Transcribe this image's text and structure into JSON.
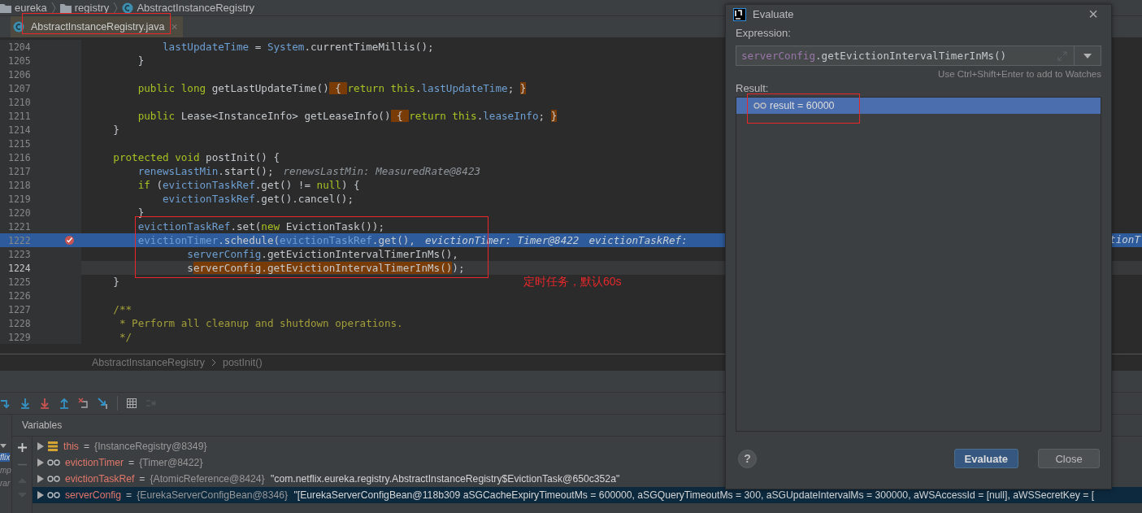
{
  "breadcrumbs": [
    {
      "kind": "folder",
      "label": "eureka"
    },
    {
      "kind": "folder",
      "label": "registry"
    },
    {
      "kind": "class",
      "label": "AbstractInstanceRegistry"
    }
  ],
  "tabs": [
    {
      "label": "AbstractInstanceRegistry.java",
      "selected": true,
      "annotated": true,
      "close": "×"
    }
  ],
  "code_lines": [
    {
      "number": "1204",
      "execution_point": false,
      "caret_line": false,
      "breakpoint": false,
      "annotated": false,
      "tokens": [
        {
          "kind": "field",
          "text": "            lastUpdateTime"
        },
        {
          "kind": "plain",
          "text": " = "
        },
        {
          "kind": "field",
          "text": "System"
        },
        {
          "kind": "plain",
          "text": ".currentTimeMillis();"
        }
      ]
    },
    {
      "number": "1205",
      "execution_point": false,
      "caret_line": false,
      "breakpoint": false,
      "annotated": false,
      "tokens": [
        {
          "kind": "plain",
          "text": "        }"
        }
      ]
    },
    {
      "number": "1206",
      "execution_point": false,
      "caret_line": false,
      "breakpoint": false,
      "annotated": false
    },
    {
      "number": "1207",
      "execution_point": false,
      "caret_line": false,
      "breakpoint": false,
      "annotated": false,
      "tokens": [
        {
          "kind": "kw",
          "text": "        public long "
        },
        {
          "kind": "plain",
          "text": "getLastUpdateTime()"
        },
        {
          "kind": "fold",
          "text": " { "
        },
        {
          "kind": "kw",
          "text": "return this"
        },
        {
          "kind": "plain",
          "text": "."
        },
        {
          "kind": "field",
          "text": "lastUpdateTime"
        },
        {
          "kind": "plain",
          "text": "; "
        },
        {
          "kind": "fold",
          "text": "}"
        }
      ]
    },
    {
      "number": "1210",
      "execution_point": false,
      "caret_line": false,
      "breakpoint": false,
      "annotated": false
    },
    {
      "number": "1211",
      "execution_point": false,
      "caret_line": false,
      "breakpoint": false,
      "annotated": false,
      "tokens": [
        {
          "kind": "kw",
          "text": "        public "
        },
        {
          "kind": "plain",
          "text": "Lease<InstanceInfo> getLeaseInfo()"
        },
        {
          "kind": "fold",
          "text": " { "
        },
        {
          "kind": "kw",
          "text": "return this"
        },
        {
          "kind": "plain",
          "text": "."
        },
        {
          "kind": "field",
          "text": "leaseInfo"
        },
        {
          "kind": "plain",
          "text": "; "
        },
        {
          "kind": "fold",
          "text": "}"
        }
      ]
    },
    {
      "number": "1214",
      "execution_point": false,
      "caret_line": false,
      "breakpoint": false,
      "annotated": false,
      "tokens": [
        {
          "kind": "plain",
          "text": "    }"
        }
      ]
    },
    {
      "number": "1215",
      "execution_point": false,
      "caret_line": false,
      "breakpoint": false,
      "annotated": false
    },
    {
      "number": "1216",
      "execution_point": false,
      "caret_line": false,
      "breakpoint": false,
      "annotated": false,
      "tokens": [
        {
          "kind": "kw",
          "text": "    protected void "
        },
        {
          "kind": "plain",
          "text": "postInit() {"
        }
      ]
    },
    {
      "number": "1217",
      "execution_point": false,
      "caret_line": false,
      "breakpoint": false,
      "annotated": false,
      "tokens": [
        {
          "kind": "field",
          "text": "        renewsLastMin"
        },
        {
          "kind": "plain",
          "text": ".start();"
        }
      ],
      "hints": [
        "renewsLastMin: MeasuredRate@8423"
      ]
    },
    {
      "number": "1218",
      "execution_point": false,
      "caret_line": false,
      "breakpoint": false,
      "annotated": false,
      "tokens": [
        {
          "kind": "kw",
          "text": "        if "
        },
        {
          "kind": "plain",
          "text": "("
        },
        {
          "kind": "field",
          "text": "evictionTaskRef"
        },
        {
          "kind": "plain",
          "text": ".get() != "
        },
        {
          "kind": "kw",
          "text": "null"
        },
        {
          "kind": "plain",
          "text": ") {"
        }
      ]
    },
    {
      "number": "1219",
      "execution_point": false,
      "caret_line": false,
      "breakpoint": false,
      "annotated": false,
      "tokens": [
        {
          "kind": "field",
          "text": "            evictionTaskRef"
        },
        {
          "kind": "plain",
          "text": ".get().cancel();"
        }
      ]
    },
    {
      "number": "1220",
      "execution_point": false,
      "caret_line": false,
      "breakpoint": false,
      "annotated": false,
      "tokens": [
        {
          "kind": "plain",
          "text": "        }"
        }
      ]
    },
    {
      "number": "1221",
      "execution_point": false,
      "caret_line": false,
      "breakpoint": false,
      "annotated": true,
      "tokens": [
        {
          "kind": "field",
          "text": "        evictionTaskRef"
        },
        {
          "kind": "plain",
          "text": ".set("
        },
        {
          "kind": "kw",
          "text": "new "
        },
        {
          "kind": "plain",
          "text": "EvictionTask());"
        }
      ]
    },
    {
      "number": "1222",
      "execution_point": true,
      "caret_line": false,
      "breakpoint": true,
      "annotated": true,
      "tokens": [
        {
          "kind": "field",
          "text": "        evictionTimer"
        },
        {
          "kind": "plain",
          "text": ".schedule("
        },
        {
          "kind": "field",
          "text": "evictionTaskRef"
        },
        {
          "kind": "plain",
          "text": ".get(),"
        }
      ],
      "hints": [
        "evictionTimer: Timer@8422",
        "evictionTaskRef:"
      ],
      "tail": "tionT"
    },
    {
      "number": "1223",
      "execution_point": false,
      "caret_line": false,
      "breakpoint": false,
      "annotated": true,
      "tokens": [
        {
          "kind": "field",
          "text": "                serverConfig"
        },
        {
          "kind": "plain",
          "text": ".getEvictionIntervalTimerInMs(),"
        }
      ]
    },
    {
      "number": "1224",
      "execution_point": false,
      "caret_line": true,
      "breakpoint": false,
      "annotated": true,
      "tokens": [
        {
          "kind": "plain",
          "text": "                s"
        },
        {
          "kind": "fold",
          "text": "erverConfig.getEvictionIntervalTimerInMs()"
        },
        {
          "kind": "plain",
          "text": ");"
        }
      ]
    },
    {
      "number": "1225",
      "execution_point": false,
      "caret_line": false,
      "breakpoint": false,
      "annotated": false,
      "tokens": [
        {
          "kind": "plain",
          "text": "    }"
        }
      ]
    },
    {
      "number": "1226",
      "execution_point": false,
      "caret_line": false,
      "breakpoint": false,
      "annotated": false
    },
    {
      "number": "1227",
      "execution_point": false,
      "caret_line": false,
      "breakpoint": false,
      "annotated": false,
      "tokens": [
        {
          "kind": "comment",
          "text": "    /**"
        }
      ]
    },
    {
      "number": "1228",
      "execution_point": false,
      "caret_line": false,
      "breakpoint": false,
      "annotated": false,
      "tokens": [
        {
          "kind": "comment",
          "text": "     * Perform all cleanup and shutdown operations."
        }
      ]
    },
    {
      "number": "1229",
      "execution_point": false,
      "caret_line": false,
      "breakpoint": false,
      "annotated": false,
      "tokens": [
        {
          "kind": "comment",
          "text": "     */"
        }
      ]
    }
  ],
  "annotation_note": "定时任务，默认60s",
  "editor_breadcrumbs": [
    "AbstractInstanceRegistry",
    "postInit()"
  ],
  "debug_toolbar": [
    {
      "kind": "step-over",
      "disabled": false
    },
    {
      "kind": "step-into",
      "disabled": false
    },
    {
      "kind": "force-step-into",
      "disabled": false
    },
    {
      "kind": "step-out",
      "disabled": false
    },
    {
      "kind": "drop-frame",
      "disabled": false
    },
    {
      "kind": "run-to-cursor",
      "disabled": false
    },
    {
      "kind": "evaluate",
      "disabled": false
    },
    {
      "kind": "trace",
      "disabled": true
    }
  ],
  "frames": [
    {
      "text": "flix",
      "selected": true
    },
    {
      "text": "mp",
      "selected": false
    },
    {
      "text": "rar",
      "selected": false
    }
  ],
  "variables": {
    "title": "Variables",
    "rows": [
      {
        "kind": "field",
        "name": "this",
        "equals": "=",
        "value": "{InstanceRegistry@8349}",
        "selected": false
      },
      {
        "kind": "watch",
        "name": "evictionTimer",
        "equals": "=",
        "value": "{Timer@8422}",
        "selected": false
      },
      {
        "kind": "watch",
        "name": "evictionTaskRef",
        "equals": "=",
        "value": "{AtomicReference@8424}",
        "string": "\"com.netflix.eureka.registry.AbstractInstanceRegistry$EvictionTask@650c352a\"",
        "selected": false
      },
      {
        "kind": "watch",
        "name": "serverConfig",
        "equals": "=",
        "value": "{EurekaServerConfigBean@8346}",
        "string": "\"[EurekaServerConfigBean@118b309 aSGCacheExpiryTimeoutMs = 600000, aSGQueryTimeoutMs = 300, aSGUpdateIntervalMs = 300000, aWSAccessId = [null], aWSSecretKey = [",
        "selected": true
      }
    ]
  },
  "dialog": {
    "title": "Evaluate",
    "close": "×",
    "expression_label": "Expression:",
    "expression": {
      "object": "serverConfig",
      "rest": ".getEvictionIntervalTimerInMs()"
    },
    "hint": "Use Ctrl+Shift+Enter to add to Watches",
    "result_label": "Result:",
    "results": [
      {
        "text": "result = 60000",
        "selected": true,
        "annotated": true
      }
    ],
    "help": "?",
    "buttons": [
      {
        "label": "Evaluate",
        "default": true
      },
      {
        "label": "Close",
        "default": false
      }
    ]
  }
}
